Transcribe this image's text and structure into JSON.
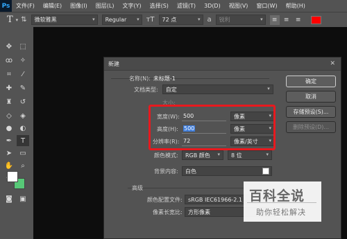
{
  "app": {
    "logo": "Ps"
  },
  "menu": [
    "文件(F)",
    "编辑(E)",
    "图像(I)",
    "图层(L)",
    "文字(Y)",
    "选择(S)",
    "滤镜(T)",
    "3D(D)",
    "视图(V)",
    "窗口(W)",
    "帮助(H)"
  ],
  "options": {
    "tool_glyph": "T",
    "font_family": "微软雅黑",
    "font_style": "Regular",
    "font_size": "72 点",
    "antialias": "锐利",
    "text_color": "#ff0000"
  },
  "dialog": {
    "title": "新建",
    "name_label": "名称(N):",
    "name_value": "未标题-1",
    "preset_label": "文档类型:",
    "preset_value": "自定",
    "size_label": "大小:",
    "width_label": "宽度(W):",
    "width_value": "500",
    "width_unit": "像素",
    "height_label": "高度(H):",
    "height_value": "500",
    "height_unit": "像素",
    "resolution_label": "分辨率(R):",
    "resolution_value": "72",
    "resolution_unit": "像素/英寸",
    "color_mode_label": "颜色模式:",
    "color_mode_value": "RGB 颜色",
    "bit_depth_value": "8 位",
    "background_label": "背景内容:",
    "background_value": "白色",
    "advanced_label": "高级",
    "color_profile_label": "颜色配置文件:",
    "color_profile_value": "sRGB IEC61966-2.1",
    "pixel_aspect_label": "像素长宽比:",
    "pixel_aspect_value": "方形像素",
    "ok_button": "确定",
    "cancel_button": "取消",
    "save_preset_button": "存储预设(S)...",
    "delete_preset_button": "删除预设(D)..."
  },
  "watermark": {
    "line1": "百科全说",
    "line2": "助你轻松解决"
  }
}
